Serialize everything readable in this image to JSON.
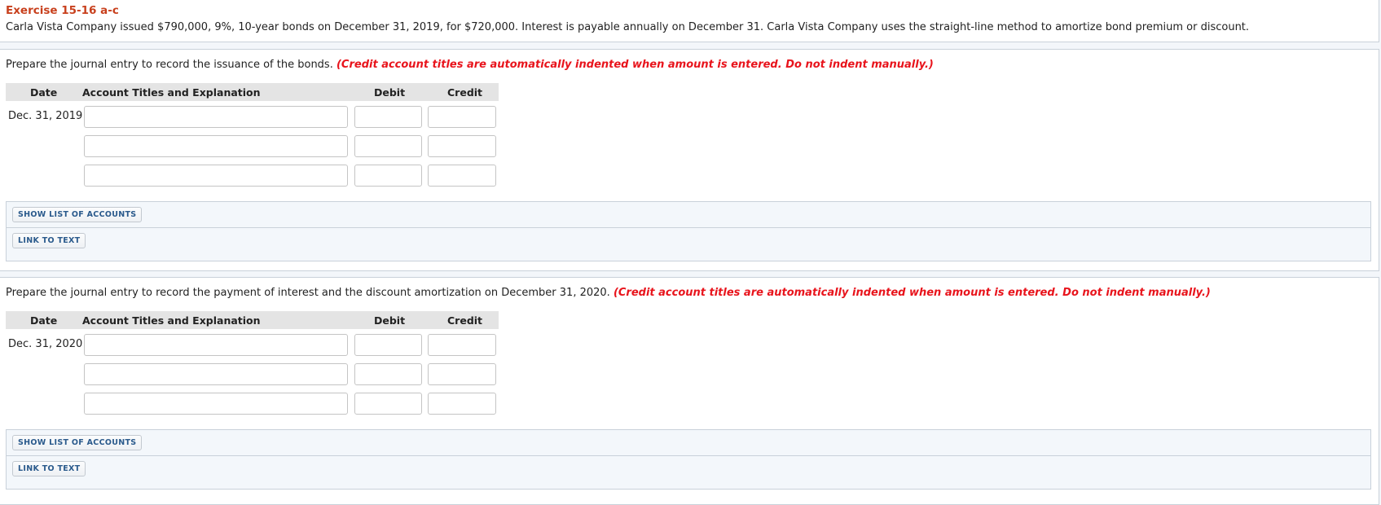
{
  "exercise": {
    "title": "Exercise 15-16 a-c",
    "description": "Carla Vista Company issued $790,000, 9%, 10-year bonds on December 31, 2019, for $720,000. Interest is payable annually on December 31. Carla Vista Company uses the straight-line method to amortize bond premium or discount."
  },
  "table_headers": {
    "date": "Date",
    "account": "Account Titles and Explanation",
    "debit": "Debit",
    "credit": "Credit"
  },
  "sections": [
    {
      "instruction": "Prepare the journal entry to record the issuance of the bonds.",
      "note": "(Credit account titles are automatically indented when amount is entered. Do not indent manually.)",
      "date": "Dec. 31, 2019",
      "rows": [
        {
          "account": "",
          "debit": "",
          "credit": ""
        },
        {
          "account": "",
          "debit": "",
          "credit": ""
        },
        {
          "account": "",
          "debit": "",
          "credit": ""
        }
      ],
      "buttons": {
        "show_accounts": "SHOW LIST OF ACCOUNTS",
        "link_to_text": "LINK TO TEXT"
      }
    },
    {
      "instruction": "Prepare the journal entry to record the payment of interest and the discount amortization on December 31, 2020.",
      "note": "(Credit account titles are automatically indented when amount is entered. Do not indent manually.)",
      "date": "Dec. 31, 2020",
      "rows": [
        {
          "account": "",
          "debit": "",
          "credit": ""
        },
        {
          "account": "",
          "debit": "",
          "credit": ""
        },
        {
          "account": "",
          "debit": "",
          "credit": ""
        }
      ],
      "buttons": {
        "show_accounts": "SHOW LIST OF ACCOUNTS",
        "link_to_text": "LINK TO TEXT"
      }
    }
  ]
}
